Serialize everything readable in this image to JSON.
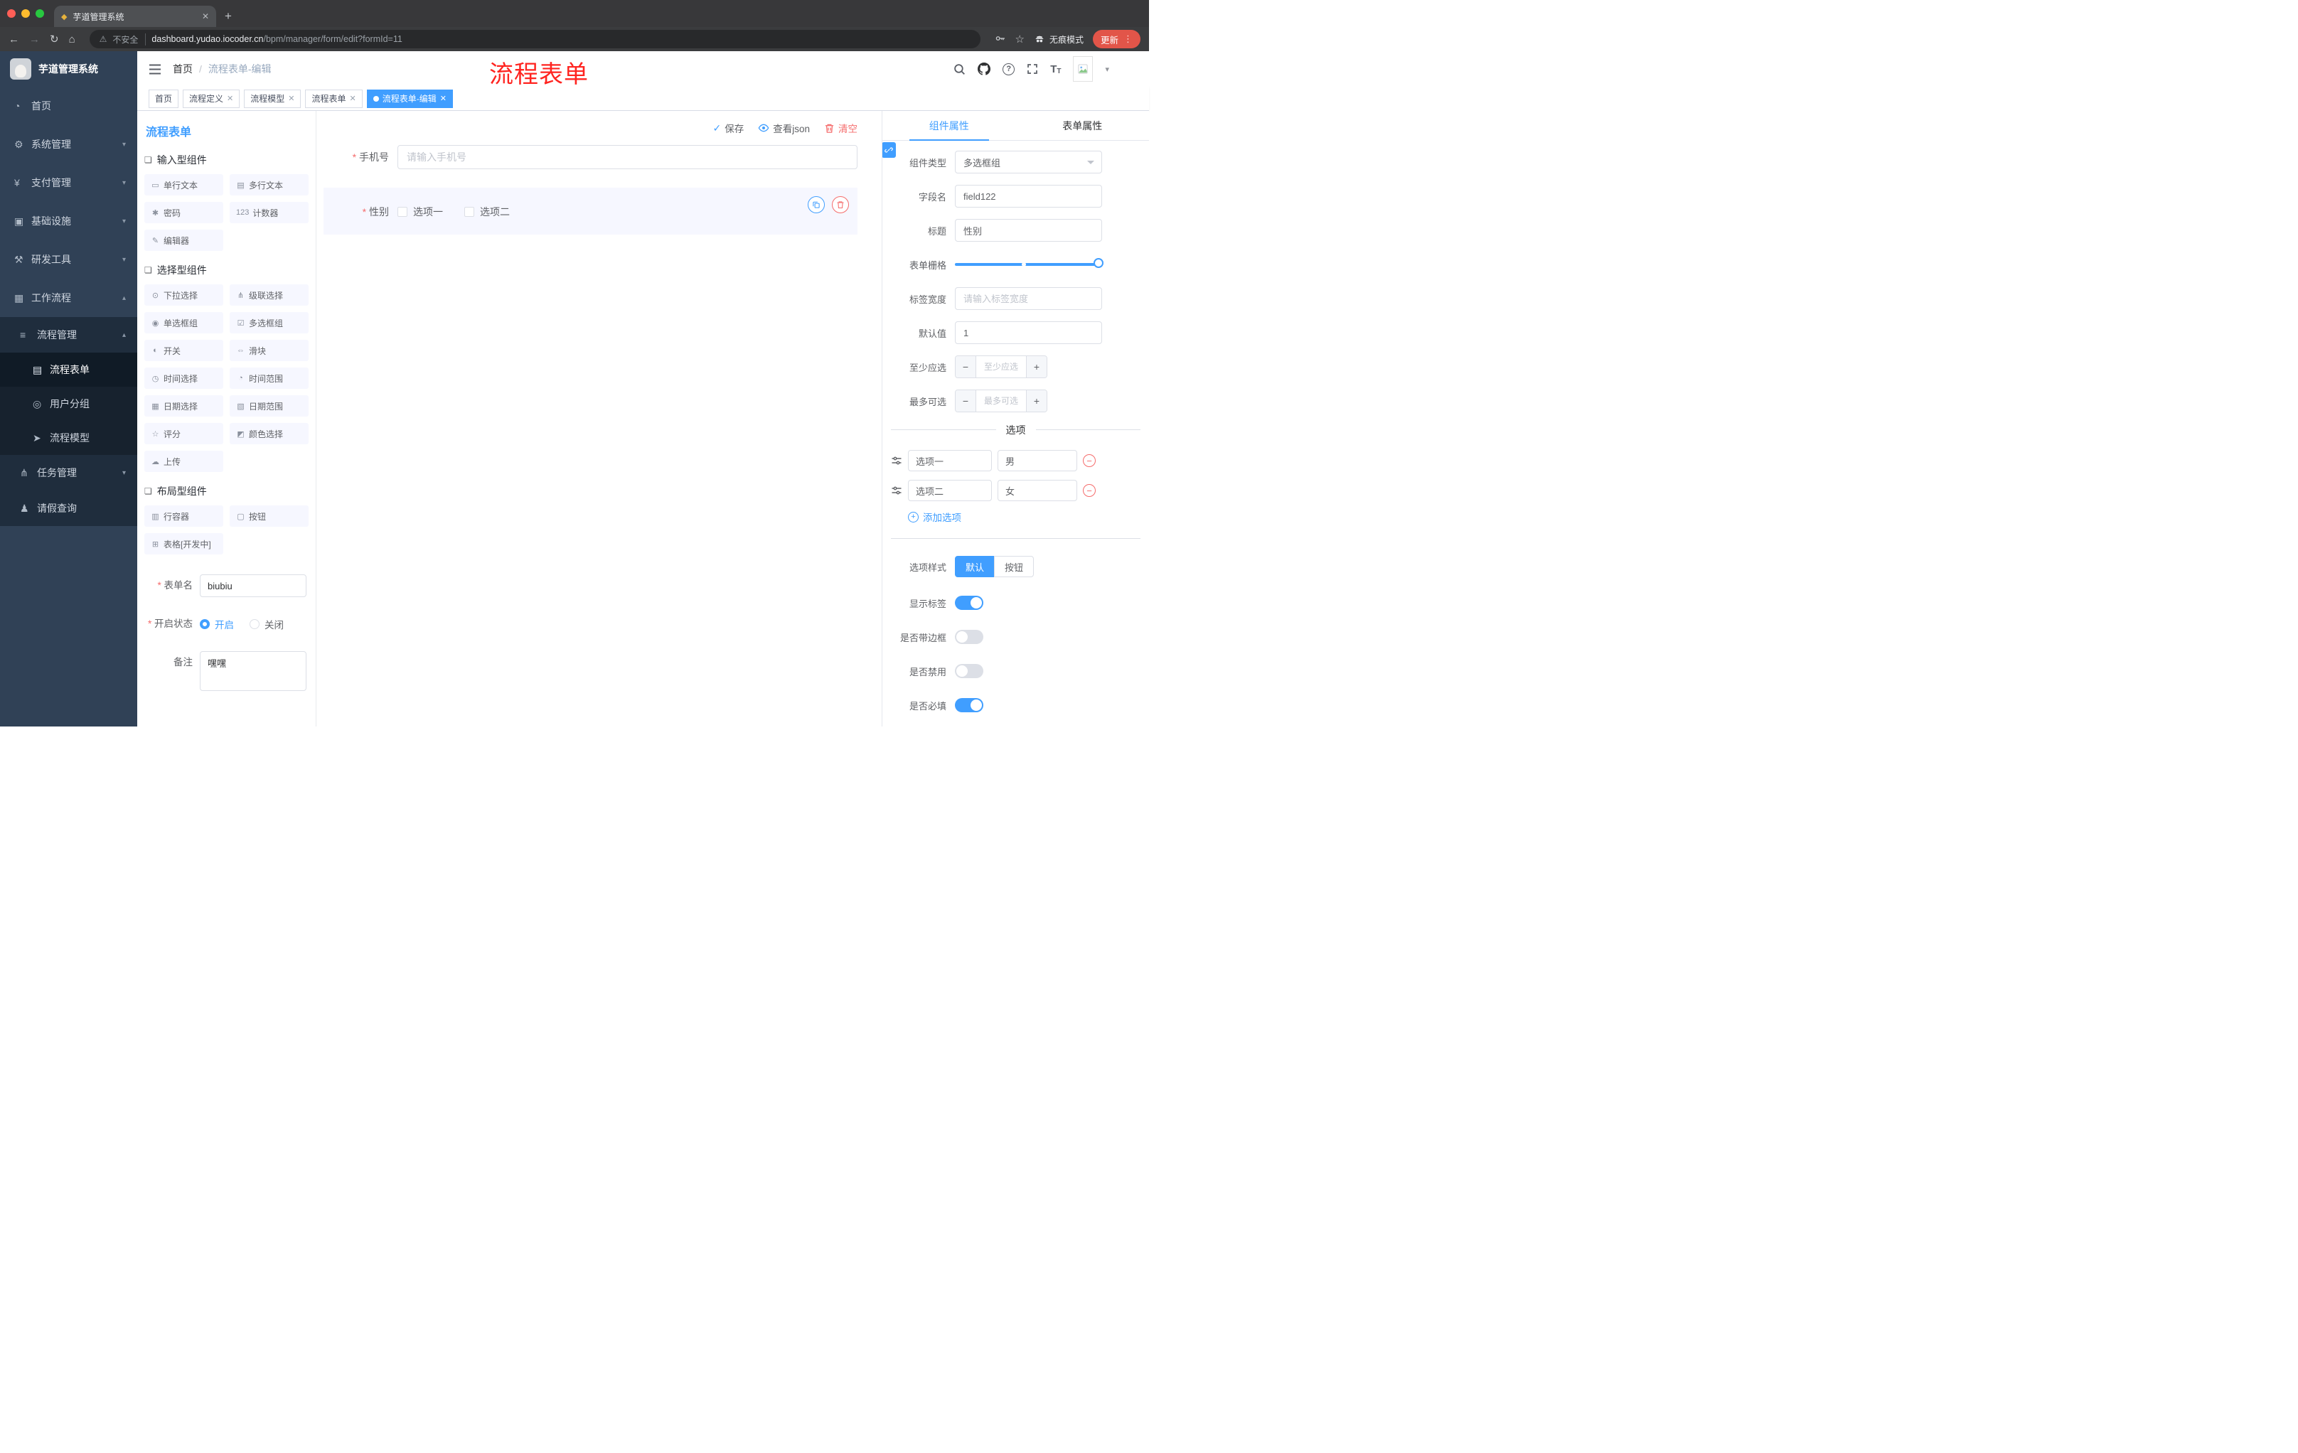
{
  "browser": {
    "tab_title": "芋道管理系统",
    "not_secure": "不安全",
    "url_domain": "dashboard.yudao.iocoder.cn",
    "url_path": "/bpm/manager/form/edit?formId=11",
    "incognito": "无痕模式",
    "update": "更新"
  },
  "sidebar": {
    "title": "芋道管理系统",
    "items": [
      {
        "label": "首页",
        "icon": "◔"
      },
      {
        "label": "系统管理",
        "icon": "⚙"
      },
      {
        "label": "支付管理",
        "icon": "¥"
      },
      {
        "label": "基础设施",
        "icon": "▣"
      },
      {
        "label": "研发工具",
        "icon": "⚒"
      },
      {
        "label": "工作流程",
        "icon": "▦"
      }
    ],
    "process_mgmt": {
      "label": "流程管理",
      "icon": "≡"
    },
    "process_children": [
      {
        "label": "流程表单",
        "icon": "▤"
      },
      {
        "label": "用户分组",
        "icon": "◎"
      },
      {
        "label": "流程模型",
        "icon": "➤"
      }
    ],
    "task_mgmt": {
      "label": "任务管理",
      "icon": "⋔"
    },
    "leave_query": {
      "label": "请假查询",
      "icon": "♟"
    }
  },
  "header": {
    "breadcrumb_home": "首页",
    "breadcrumb_current": "流程表单-编辑",
    "annotation": "流程表单"
  },
  "tags": [
    {
      "label": "首页"
    },
    {
      "label": "流程定义"
    },
    {
      "label": "流程模型"
    },
    {
      "label": "流程表单"
    },
    {
      "label": "流程表单-编辑"
    }
  ],
  "panel": {
    "title": "流程表单",
    "groups": [
      {
        "title": "输入型组件",
        "items": [
          {
            "label": "单行文本",
            "icon": "▭"
          },
          {
            "label": "多行文本",
            "icon": "▤"
          },
          {
            "label": "密码",
            "icon": "✱"
          },
          {
            "label": "计数器",
            "icon": "123"
          },
          {
            "label": "编辑器",
            "icon": "✎"
          }
        ]
      },
      {
        "title": "选择型组件",
        "items": [
          {
            "label": "下拉选择",
            "icon": "⊙"
          },
          {
            "label": "级联选择",
            "icon": "⋔"
          },
          {
            "label": "单选框组",
            "icon": "◉"
          },
          {
            "label": "多选框组",
            "icon": "☑"
          },
          {
            "label": "开关",
            "icon": "◐"
          },
          {
            "label": "滑块",
            "icon": "⇔"
          },
          {
            "label": "时间选择",
            "icon": "◷"
          },
          {
            "label": "时间范围",
            "icon": "◔"
          },
          {
            "label": "日期选择",
            "icon": "▦"
          },
          {
            "label": "日期范围",
            "icon": "▧"
          },
          {
            "label": "评分",
            "icon": "☆"
          },
          {
            "label": "颜色选择",
            "icon": "◩"
          },
          {
            "label": "上传",
            "icon": "☁"
          }
        ]
      },
      {
        "title": "布局型组件",
        "items": [
          {
            "label": "行容器",
            "icon": "▥"
          },
          {
            "label": "按钮",
            "icon": "▢"
          },
          {
            "label": "表格[开发中]",
            "icon": "⊞"
          }
        ]
      }
    ],
    "meta": {
      "name_label": "表单名",
      "name_value": "biubiu",
      "status_label": "开启状态",
      "status_on": "开启",
      "status_off": "关闭",
      "remark_label": "备注",
      "remark_value": "嘿嘿"
    }
  },
  "canvas": {
    "save": "保存",
    "view_json": "查看json",
    "clear": "清空",
    "phone_label": "手机号",
    "phone_placeholder": "请输入手机号",
    "gender_label": "性别",
    "gender_opt1": "选项一",
    "gender_opt2": "选项二"
  },
  "inspector": {
    "tab_component": "组件属性",
    "tab_form": "表单属性",
    "type_label": "组件类型",
    "type_value": "多选框组",
    "field_label": "字段名",
    "field_value": "field122",
    "title_label": "标题",
    "title_value": "性别",
    "grid_label": "表单栅格",
    "width_label": "标签宽度",
    "width_placeholder": "请输入标签宽度",
    "default_label": "默认值",
    "default_value": "1",
    "min_label": "至少应选",
    "min_placeholder": "至少应选",
    "max_label": "最多可选",
    "max_placeholder": "最多可选",
    "options_title": "选项",
    "options": [
      {
        "label": "选项一",
        "value": "男"
      },
      {
        "label": "选项二",
        "value": "女"
      }
    ],
    "add_option": "添加选项",
    "style_label": "选项样式",
    "style_default": "默认",
    "style_button": "按钮",
    "show_label": "显示标签",
    "border_label": "是否带边框",
    "disabled_label": "是否禁用",
    "required_label": "是否必填"
  }
}
